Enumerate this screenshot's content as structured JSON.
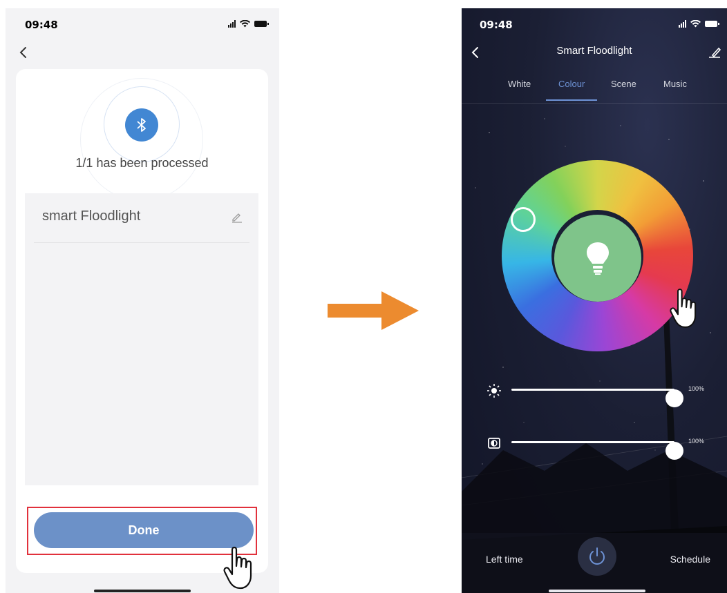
{
  "left_screen": {
    "status": {
      "time": "09:48"
    },
    "processed_text": "1/1 has been processed",
    "device": {
      "name": "smart Floodlight"
    },
    "done_label": "Done"
  },
  "right_screen": {
    "status": {
      "time": "09:48"
    },
    "title": "Smart Floodlight",
    "tabs": [
      {
        "label": "White"
      },
      {
        "label": "Colour",
        "active": true
      },
      {
        "label": "Scene"
      },
      {
        "label": "Music"
      }
    ],
    "brightness": {
      "value_label": "100%",
      "level": 1.0
    },
    "contrast": {
      "value_label": "100%",
      "level": 1.0
    },
    "bottom": {
      "left_time": "Left time",
      "schedule": "Schedule"
    }
  },
  "colors": {
    "accent_blue": "#4287d3",
    "done_button": "#6c91c8",
    "highlight_red": "#e1313c",
    "arrow_orange": "#ec8b2f",
    "bulb_green": "#7fc48a",
    "tab_active": "#6e93d6"
  },
  "icons": [
    "chevron-left-icon",
    "bluetooth-icon",
    "pencil-icon",
    "hand-pointer-icon",
    "arrow-right-icon",
    "edit-icon",
    "lightbulb-icon",
    "sun-icon",
    "contrast-icon",
    "power-icon",
    "signal-icon",
    "wifi-icon",
    "battery-icon"
  ]
}
